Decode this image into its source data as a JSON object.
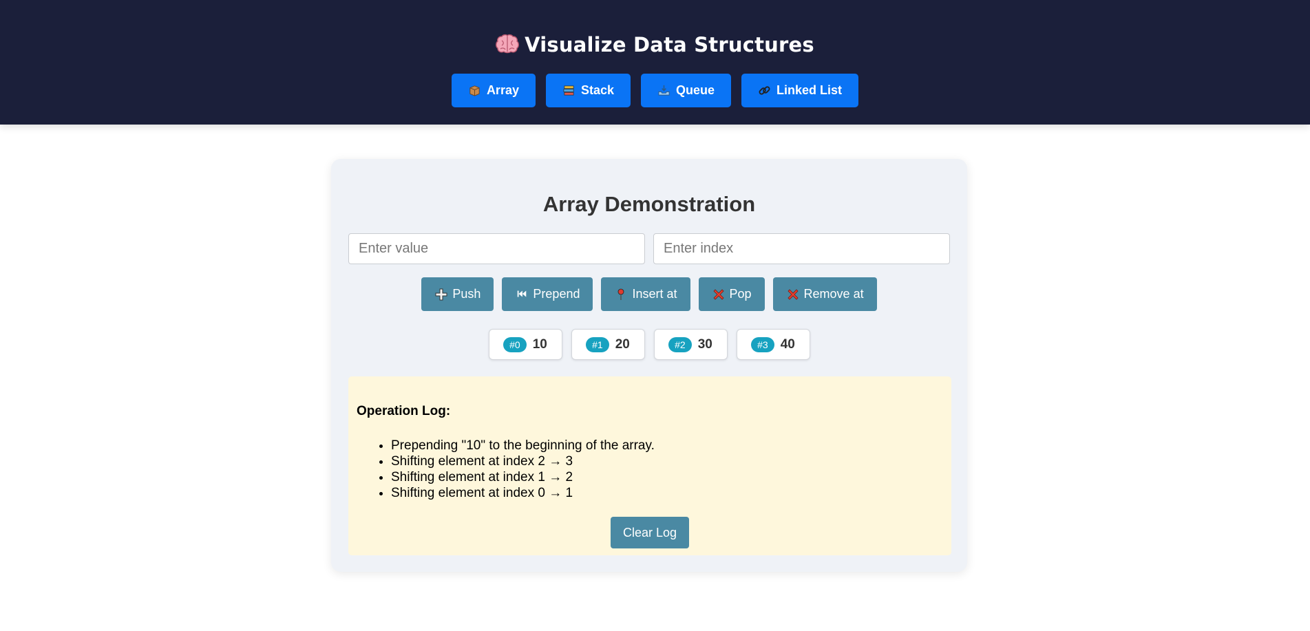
{
  "header": {
    "title": "Visualize Data Structures",
    "brand_icon": "brain-icon",
    "nav": [
      {
        "label": "Array",
        "icon": "box-icon"
      },
      {
        "label": "Stack",
        "icon": "stack-books-icon"
      },
      {
        "label": "Queue",
        "icon": "inbox-tray-icon"
      },
      {
        "label": "Linked List",
        "icon": "link-icon"
      }
    ]
  },
  "main": {
    "title": "Array Demonstration",
    "inputs": {
      "value_placeholder": "Enter value",
      "value": "",
      "index_placeholder": "Enter index",
      "index": ""
    },
    "actions": [
      {
        "label": "Push",
        "icon": "plus-icon"
      },
      {
        "label": "Prepend",
        "icon": "skip-back-icon"
      },
      {
        "label": "Insert at",
        "icon": "pushpin-icon"
      },
      {
        "label": "Pop",
        "icon": "cross-mark-icon"
      },
      {
        "label": "Remove at",
        "icon": "cross-mark-icon"
      }
    ],
    "array": [
      {
        "index": "#0",
        "value": "10"
      },
      {
        "index": "#1",
        "value": "20"
      },
      {
        "index": "#2",
        "value": "30"
      },
      {
        "index": "#3",
        "value": "40"
      }
    ],
    "log": {
      "title": "Operation Log:",
      "entries": [
        "Prepending \"10\" to the beginning of the array.",
        "Shifting element at index 2 → 3",
        "Shifting element at index 1 → 2",
        "Shifting element at index 0 → 1"
      ],
      "clear_label": "Clear Log"
    }
  },
  "colors": {
    "header_bg": "#1b1f3a",
    "nav_button": "#0a74f5",
    "action_button": "#4a89a3",
    "card_bg": "#eff2f7",
    "index_badge": "#17a2c0",
    "log_bg": "#fef7dc"
  }
}
